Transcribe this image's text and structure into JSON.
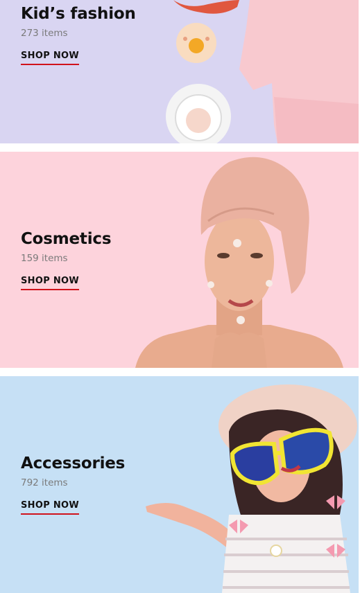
{
  "categories": [
    {
      "title": "Kid’s fashion",
      "count": "273 items",
      "cta": "SHOP NOW"
    },
    {
      "title": "Cosmetics",
      "count": "159 items",
      "cta": "SHOP NOW"
    },
    {
      "title": "Accessories",
      "count": "792 items",
      "cta": "SHOP NOW"
    }
  ],
  "colors": {
    "kids_bg": "#d9d5f2",
    "cosmetics_bg": "#fdd3dc",
    "accessories_bg": "#c6e0f5",
    "cta_underline": "#d0121b"
  }
}
